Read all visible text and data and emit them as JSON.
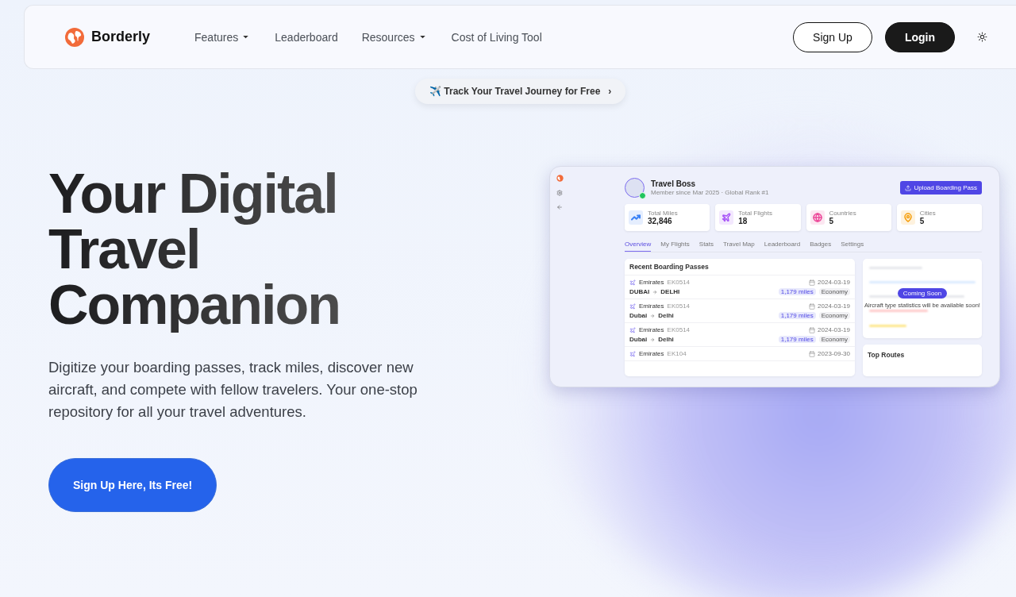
{
  "nav": {
    "brand": "Borderly",
    "links": [
      {
        "label": "Features",
        "dropdown": true
      },
      {
        "label": "Leaderboard",
        "dropdown": false
      },
      {
        "label": "Resources",
        "dropdown": true
      },
      {
        "label": "Cost of Living Tool",
        "dropdown": false
      }
    ],
    "signup": "Sign Up",
    "login": "Login"
  },
  "announcement": {
    "text": "✈️ Track Your Travel Journey for Free",
    "chevron": "›"
  },
  "hero": {
    "title": "Your Digital Travel Companion",
    "description": "Digitize your boarding passes, track miles, discover new aircraft, and compete with fellow travelers. Your one-stop repository for all your travel adventures.",
    "cta": "Sign Up Here, Its Free!"
  },
  "preview": {
    "profile": {
      "name": "Travel Boss",
      "subtitle": "Member since Mar 2025 · Global Rank #1"
    },
    "upload_button": "Upload Boarding Pass",
    "stats": [
      {
        "label": "Total Miles",
        "value": "32,846",
        "color": "#3b82f6"
      },
      {
        "label": "Total Flights",
        "value": "18",
        "color": "#a855f7"
      },
      {
        "label": "Countries",
        "value": "5",
        "color": "#ec4899"
      },
      {
        "label": "Cities",
        "value": "5",
        "color": "#f59e0b"
      }
    ],
    "tabs": [
      {
        "label": "Overview",
        "selected": true
      },
      {
        "label": "My Flights",
        "selected": false
      },
      {
        "label": "Stats",
        "selected": false
      },
      {
        "label": "Travel Map",
        "selected": false
      },
      {
        "label": "Leaderboard",
        "selected": false
      },
      {
        "label": "Badges",
        "selected": false
      },
      {
        "label": "Settings",
        "selected": false
      }
    ],
    "passes_title": "Recent Boarding Passes",
    "passes": [
      {
        "airline": "Emirates",
        "code": "EK0514",
        "date": "2024-03-19",
        "from": "DUBAI",
        "to": "DELHI",
        "miles": "1,179 miles",
        "class": "Economy"
      },
      {
        "airline": "Emirates",
        "code": "EK0514",
        "date": "2024-03-19",
        "from": "Dubai",
        "to": "Delhi",
        "miles": "1,179 miles",
        "class": "Economy"
      },
      {
        "airline": "Emirates",
        "code": "EK0514",
        "date": "2024-03-19",
        "from": "Dubai",
        "to": "Delhi",
        "miles": "1,179 miles",
        "class": "Economy"
      },
      {
        "airline": "Emirates",
        "code": "EK104",
        "date": "2023-09-30"
      }
    ],
    "coming_soon": {
      "badge": "Coming Soon",
      "message": "Aircraft type statistics will be available soon!"
    },
    "top_routes": "Top Routes"
  }
}
